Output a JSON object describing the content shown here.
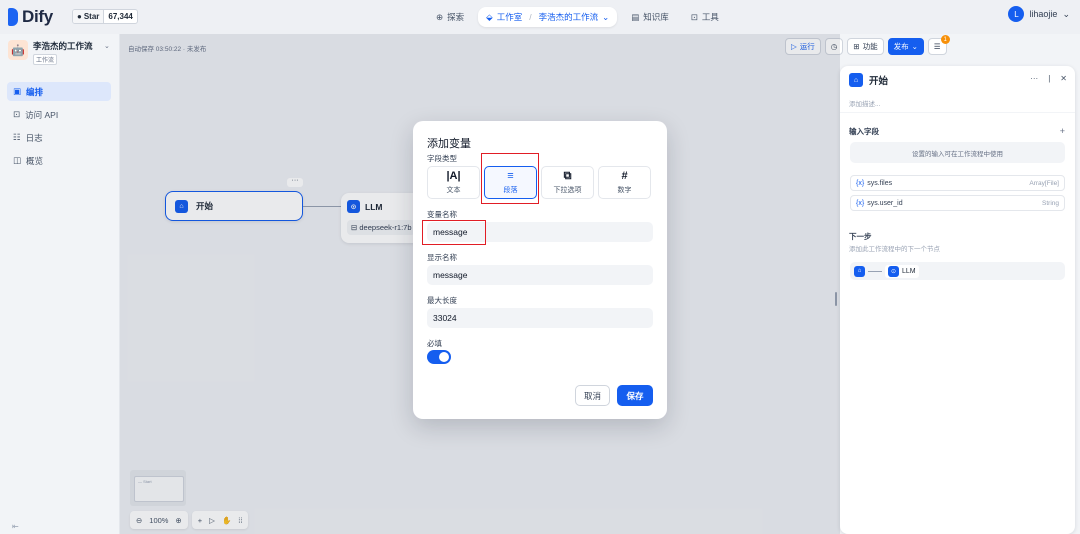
{
  "header": {
    "brand": "Dify",
    "github_star_label": "Star",
    "github_star_count": "67,344",
    "nav": [
      {
        "label": "探索"
      },
      {
        "label": "工作室"
      },
      {
        "label": "李浩杰的工作流"
      },
      {
        "label": "知识库"
      },
      {
        "label": "工具"
      }
    ],
    "user": {
      "initial": "L",
      "name": "lihaojie"
    }
  },
  "sidebar": {
    "app_title": "李浩杰的工作流",
    "app_tag": "工作流",
    "items": [
      {
        "label": "编排",
        "active": true
      },
      {
        "label": "访问 API"
      },
      {
        "label": "日志"
      },
      {
        "label": "概览"
      }
    ],
    "collapse_icon": "collapse-left-icon"
  },
  "canvas": {
    "autosave": "自动保存 03:50:22 · 未发布",
    "toolbar": {
      "run_label": "运行",
      "features_label": "功能",
      "publish_label": "发布",
      "notify_count": "1"
    },
    "start_node": {
      "label": "开始"
    },
    "llm_node": {
      "label": "LLM",
      "model": "deepseek-r1:7b"
    },
    "minimap_label": "— Start",
    "zoom_label": "100%"
  },
  "panel": {
    "title": "开始",
    "desc_placeholder": "添加描述...",
    "input_fields_label": "输入字段",
    "input_hint": "设置的输入可在工作流程中使用",
    "vars": [
      {
        "name": "sys.files",
        "type": "Array[File]"
      },
      {
        "name": "sys.user_id",
        "type": "String"
      }
    ],
    "next_step_label": "下一步",
    "next_step_desc": "添加此工作流程中的下一个节点",
    "next_node_label": "LLM"
  },
  "modal": {
    "title": "添加变量",
    "field_type_label": "字段类型",
    "types": [
      {
        "glyph": "|A|",
        "label": "文本"
      },
      {
        "glyph": "≡",
        "label": "段落",
        "selected": true
      },
      {
        "glyph": "⧉",
        "label": "下拉选项"
      },
      {
        "glyph": "#",
        "label": "数字"
      }
    ],
    "var_name_label": "变量名称",
    "var_name_value": "message",
    "display_name_label": "显示名称",
    "display_name_value": "message",
    "max_length_label": "最大长度",
    "max_length_value": "33024",
    "required_label": "必填",
    "required_on": true,
    "cancel_label": "取消",
    "save_label": "保存"
  },
  "colors": {
    "accent": "#155eef",
    "highlight": "#e11d25"
  }
}
